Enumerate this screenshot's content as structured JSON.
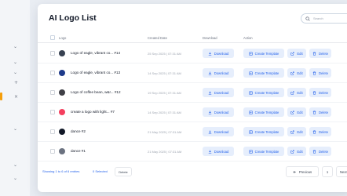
{
  "page": {
    "title": "AI Logo List"
  },
  "search": {
    "placeholder": "Search"
  },
  "table": {
    "columns": [
      "Logo",
      "Created Date",
      "Download",
      "Action"
    ],
    "rows": [
      {
        "name": "Logo of eagle, vibrant co... #14",
        "date": "25 Sep 2025 | 07:31 AM",
        "logo_color": "#374151",
        "download": "Download",
        "create": "Create Template",
        "edit": "Edit",
        "delete": "Delete"
      },
      {
        "name": "Logo of eagle, vibrant co... #13",
        "date": "14 Sep 2025 | 07:31 AM",
        "logo_color": "#1e3a8a",
        "download": "Download",
        "create": "Create Template",
        "edit": "Edit",
        "delete": "Delete"
      },
      {
        "name": "Logo of coffee bean, w&r... #12",
        "date": "19 Sep 2025 | 07:31 AM",
        "logo_color": "#3f3f46",
        "download": "Download",
        "create": "Create Template",
        "edit": "Edit",
        "delete": "Delete"
      },
      {
        "name": "create a logo with light... #7",
        "date": "14 Sep 2025 | 07:31 AM",
        "logo_color": "#f43f5e",
        "download": "Download",
        "create": "Create Template",
        "edit": "Edit",
        "delete": "Delete"
      },
      {
        "name": "dance #2",
        "date": "21 May 2025 | 07:31 AM",
        "logo_color": "#111827",
        "download": "Download",
        "create": "Create Template",
        "edit": "Edit",
        "delete": "Delete"
      },
      {
        "name": "dance #1",
        "date": "21 May 2025 | 07:31 AM",
        "logo_color": "#6b7280",
        "download": "Download",
        "create": "Create Template",
        "edit": "Edit",
        "delete": "Delete"
      }
    ]
  },
  "footer": {
    "showing": "Showing 1 to 6 of 6 entries",
    "selected": "0 Selected",
    "delete": "Delete"
  },
  "pagination": {
    "previous": "Previous",
    "page": "1",
    "next": "Next"
  },
  "rail": {
    "marks": [
      "⌄",
      "⌄",
      "⌄",
      "+",
      "×",
      "⌄",
      "⌄",
      "⌄"
    ]
  }
}
